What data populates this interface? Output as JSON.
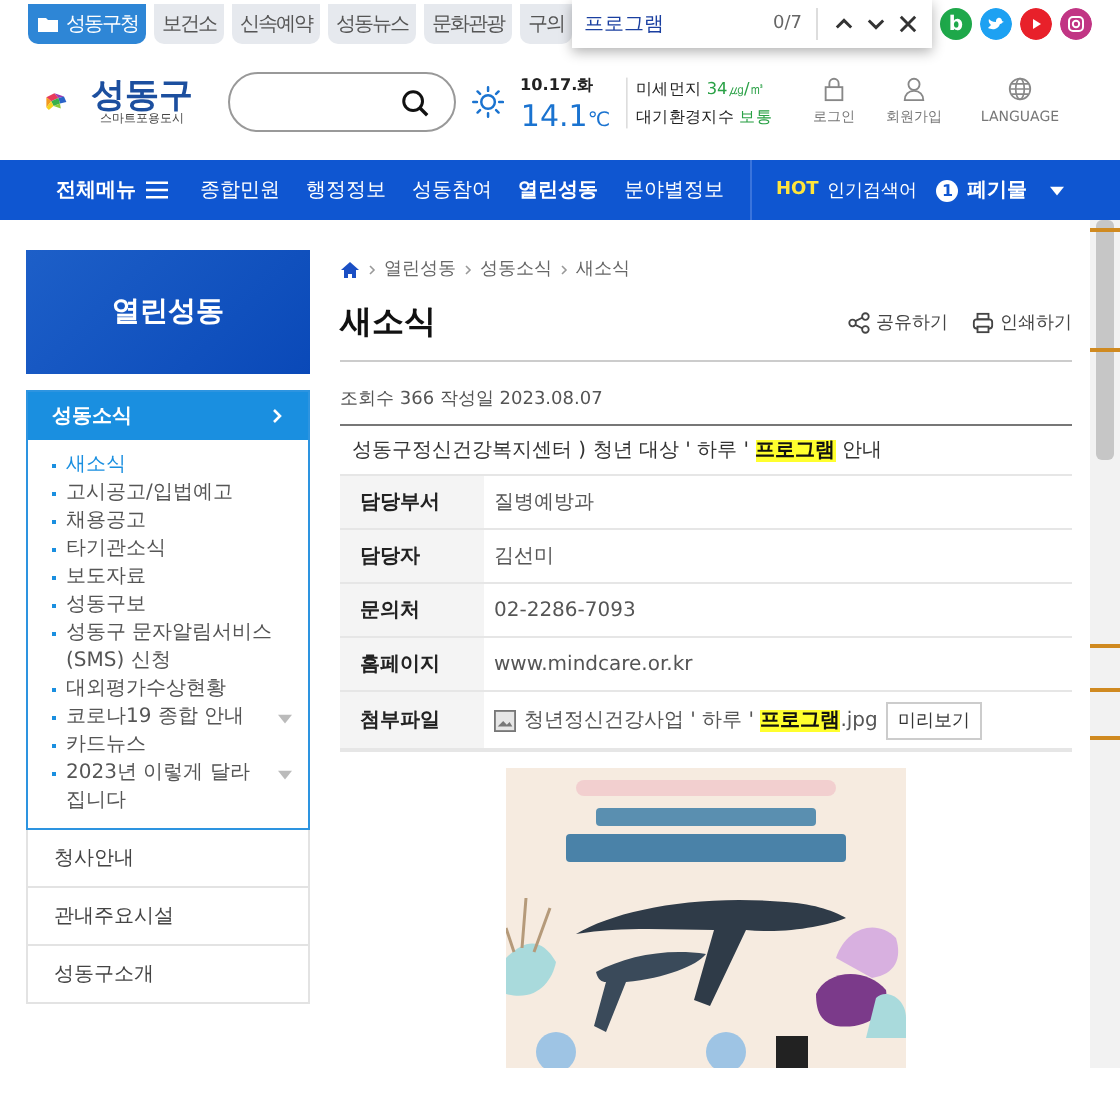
{
  "top_tabs": [
    {
      "label": "성동구청",
      "selected": true
    },
    {
      "label": "보건소",
      "selected": false
    },
    {
      "label": "신속예약",
      "selected": false
    },
    {
      "label": "성동뉴스",
      "selected": false
    },
    {
      "label": "문화관광",
      "selected": false
    },
    {
      "label": "구의",
      "selected": false
    }
  ],
  "social": [
    {
      "kind": "blog",
      "label": "b"
    },
    {
      "kind": "twitter"
    },
    {
      "kind": "youtube"
    },
    {
      "kind": "instagram"
    }
  ],
  "find_bar": {
    "value": "프로그램",
    "count": "0/7"
  },
  "logo": {
    "name": "성동구",
    "tagline": "스마트포용도시"
  },
  "weather": {
    "date": "10.17.화",
    "temp": "14.1",
    "unit": "℃",
    "dust_label": "미세먼지",
    "dust_value": "34㎍/㎥",
    "air_label": "대기환경지수",
    "air_value": "보통"
  },
  "utils": [
    {
      "kind": "lock",
      "label": "로그인"
    },
    {
      "kind": "person",
      "label": "회원가입"
    },
    {
      "kind": "globe",
      "label": "LANGUAGE"
    }
  ],
  "nav": {
    "all_menu": "전체메뉴",
    "items": [
      {
        "label": "종합민원",
        "selected": false
      },
      {
        "label": "행정정보",
        "selected": false
      },
      {
        "label": "성동참여",
        "selected": false
      },
      {
        "label": "열린성동",
        "selected": true
      },
      {
        "label": "분야별정보",
        "selected": false
      }
    ],
    "hot_tag": "HOT",
    "hot_label": "인기검색어",
    "hot_rank": "1",
    "hot_term": "폐기물"
  },
  "sidebar": {
    "title": "열린성동",
    "section": "성동소식",
    "items": [
      {
        "label": "새소식",
        "selected": true,
        "expandable": false
      },
      {
        "label": "고시공고/입법예고",
        "selected": false,
        "expandable": false
      },
      {
        "label": "채용공고",
        "selected": false,
        "expandable": false
      },
      {
        "label": "타기관소식",
        "selected": false,
        "expandable": false
      },
      {
        "label": "보도자료",
        "selected": false,
        "expandable": false
      },
      {
        "label": "성동구보",
        "selected": false,
        "expandable": false
      },
      {
        "label": "성동구 문자알림서비스(SMS) 신청",
        "selected": false,
        "expandable": false
      },
      {
        "label": "대외평가수상현황",
        "selected": false,
        "expandable": false
      },
      {
        "label": "코로나19 종합 안내",
        "selected": false,
        "expandable": true
      },
      {
        "label": "카드뉴스",
        "selected": false,
        "expandable": false
      },
      {
        "label": "2023년 이렇게 달라집니다",
        "selected": false,
        "expandable": true
      }
    ],
    "other_sections": [
      "청사안내",
      "관내주요시설",
      "성동구소개"
    ]
  },
  "breadcrumb": [
    "열린성동",
    "성동소식",
    "새소식"
  ],
  "page_title": "새소식",
  "actions": [
    {
      "kind": "share",
      "label": "공유하기"
    },
    {
      "kind": "print",
      "label": "인쇄하기"
    }
  ],
  "meta": "조회수 366 작성일 2023.08.07",
  "post_title": [
    {
      "text": "성동구정신건강복지센터 ) 청년 대상 ' 하루 ' ",
      "highlighted": false
    },
    {
      "text": "프로그램",
      "highlighted": true
    },
    {
      "text": " 안내",
      "highlighted": false
    }
  ],
  "fields": [
    {
      "label": "담당부서",
      "value": "질병예방과"
    },
    {
      "label": "담당자",
      "value": "김선미"
    },
    {
      "label": "문의처",
      "value": "02-2286-7093"
    },
    {
      "label": "홈페이지",
      "value": "www.mindcare.or.kr"
    }
  ],
  "attachment": {
    "label": "첨부파일",
    "name_parts": [
      {
        "text": "청년정신건강사업 ' 하루 ' ",
        "highlighted": false
      },
      {
        "text": "프로그램",
        "highlighted": true
      },
      {
        "text": ".jpg",
        "highlighted": false
      }
    ],
    "preview": "미리보기"
  },
  "poster": {
    "kind": "picture"
  }
}
